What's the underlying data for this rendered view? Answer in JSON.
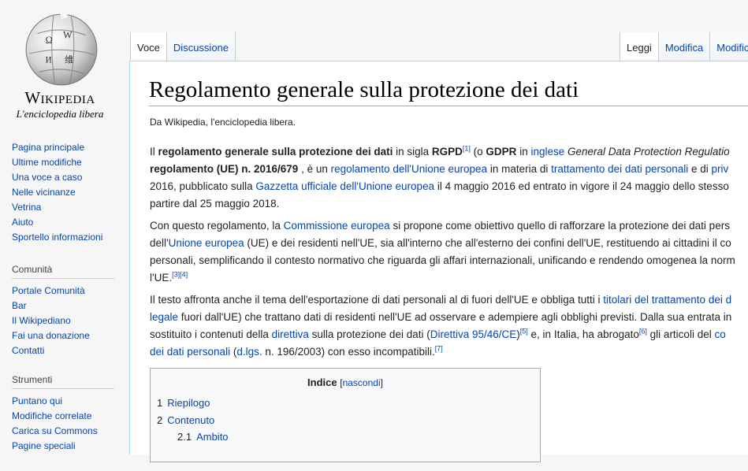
{
  "logo": {
    "wordmark": "Wikipedia",
    "tagline": "L'enciclopedia libera"
  },
  "tabs": {
    "left": [
      "Voce",
      "Discussione"
    ],
    "right": [
      "Leggi",
      "Modifica",
      "Modific"
    ]
  },
  "sidebar": {
    "nav": [
      "Pagina principale",
      "Ultime modifiche",
      "Una voce a caso",
      "Nelle vicinanze",
      "Vetrina",
      "Aiuto",
      "Sportello informazioni"
    ],
    "community": {
      "heading": "Comunità",
      "items": [
        "Portale Comunità",
        "Bar",
        "Il Wikipediano",
        "Fai una donazione",
        "Contatti"
      ]
    },
    "tools": {
      "heading": "Strumenti",
      "items": [
        "Puntano qui",
        "Modifiche correlate",
        "Carica su Commons",
        "Pagine speciali"
      ]
    }
  },
  "article": {
    "title": "Regolamento generale sulla protezione dei dati",
    "sitesub": "Da Wikipedia, l'enciclopedia libera.",
    "p1": {
      "l1": [
        "Il ",
        "regolamento generale sulla protezione dei dati",
        " in sigla ",
        "RGPD",
        "[1]",
        " (o ",
        "GDPR",
        " in ",
        "inglese",
        " ",
        "General Data Protection Regulatio"
      ],
      "l2": [
        "regolamento (UE) n. 2016/679",
        " , è un ",
        "regolamento dell'Unione europea",
        " in materia di ",
        "trattamento dei dati personali",
        " e di ",
        "priv"
      ],
      "l3": [
        "2016, pubblicato sulla ",
        "Gazzetta ufficiale dell'Unione europea",
        " il 4 maggio 2016 ed entrato in vigore il 24 maggio dello stesso"
      ],
      "l4": [
        "partire dal 25 maggio 2018."
      ]
    },
    "p2": {
      "l1": [
        "Con questo regolamento, la ",
        "Commissione europea",
        " si propone come obiettivo quello di rafforzare la protezione dei dati pers"
      ],
      "l2": [
        "dell'",
        "Unione europea",
        " (UE) e dei residenti nell'UE, sia all'interno che all'esterno dei confini dell'UE, restituendo ai cittadini il co"
      ],
      "l3": [
        "personali, semplificando il contesto normativo che riguarda gli affari internazionali, unificando e rendendo omogenea la norm"
      ],
      "l4": [
        "l'UE.",
        "[3]",
        "[4]"
      ]
    },
    "p3": {
      "l1": [
        "Il testo affronta anche il tema dell'esportazione di dati personali al di fuori dell'UE e obbliga tutti i ",
        "titolari del trattamento dei d"
      ],
      "l2": [
        "legale",
        " fuori dall'UE) che trattano dati di residenti nell'UE ad osservare e adempiere agli obblighi previsti. Dalla sua entrata in"
      ],
      "l3": [
        "sostituito i contenuti della ",
        "direttiva",
        " sulla protezione dei dati (",
        "Direttiva 95/46/CE",
        ")",
        "[5]",
        " e, in Italia, ha abrogato",
        "[6]",
        " gli articoli del ",
        "co"
      ],
      "l4": [
        "dei dati personali",
        " (",
        "d.lgs.",
        " n. 196/2003) con esso incompatibili.",
        "[7]"
      ]
    }
  },
  "toc": {
    "title": "Indice",
    "toggle": "nascondi",
    "items": [
      {
        "num": "1",
        "label": "Riepilogo"
      },
      {
        "num": "2",
        "label": "Contenuto"
      },
      {
        "num": "2.1",
        "label": "Ambito"
      }
    ]
  }
}
